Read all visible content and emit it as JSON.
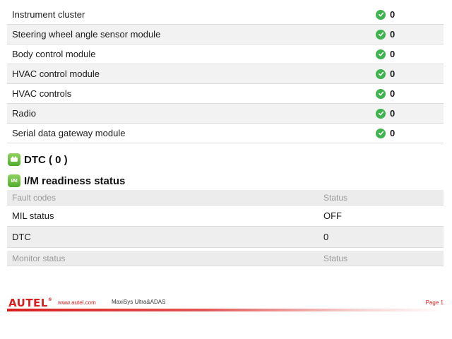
{
  "modules": [
    {
      "name": "Instrument cluster",
      "count": "0"
    },
    {
      "name": "Steering wheel angle sensor module",
      "count": "0"
    },
    {
      "name": "Body control module",
      "count": "0"
    },
    {
      "name": "HVAC control module",
      "count": "0"
    },
    {
      "name": "HVAC controls",
      "count": "0"
    },
    {
      "name": "Radio",
      "count": "0"
    },
    {
      "name": "Serial data gateway module",
      "count": "0"
    }
  ],
  "dtc_section": {
    "title": "DTC ( 0 )",
    "icon": "dtc-icon"
  },
  "im_section": {
    "title": "I/M readiness status",
    "icon_text": "I/M"
  },
  "fault_table": {
    "headers": [
      "Fault codes",
      "Status"
    ],
    "rows": [
      {
        "label": "MIL status",
        "value": "OFF"
      },
      {
        "label": "DTC",
        "value": "0"
      }
    ]
  },
  "monitor_table": {
    "headers": [
      "Monitor status",
      "Status"
    ]
  },
  "footer": {
    "logo": "AUTEL",
    "logo_mark": "®",
    "url": "www.autel.com",
    "product": "MaxiSys Ultra&ADAS",
    "page": "Page 1"
  },
  "colors": {
    "brand_red": "#d81e1e",
    "ok_green": "#3fb34f"
  }
}
